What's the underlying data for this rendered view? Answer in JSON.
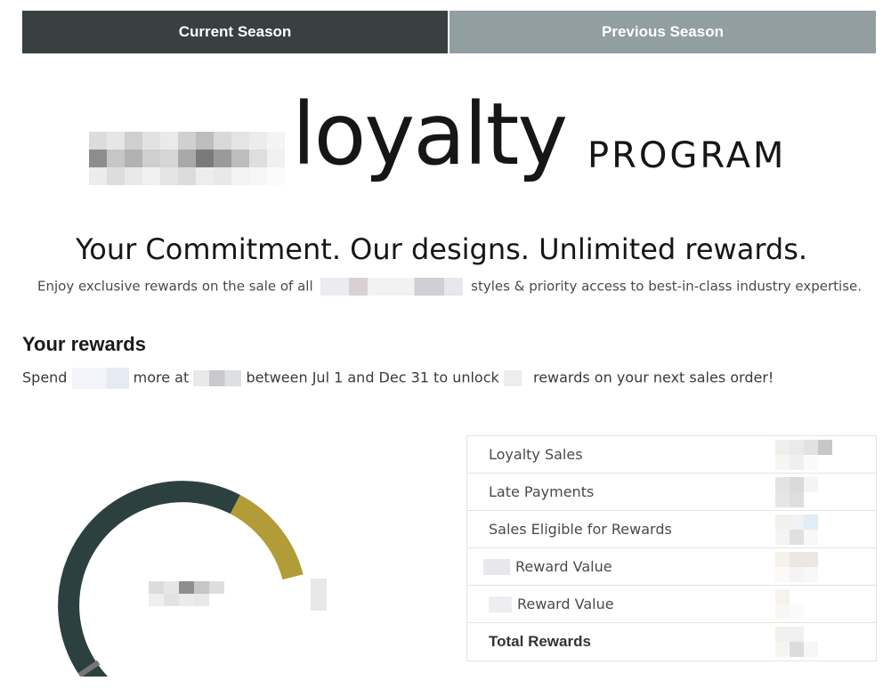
{
  "tabs": {
    "current": "Current Season",
    "previous": "Previous Season"
  },
  "logo": {
    "word": "loyalty",
    "suffix": "PROGRAM"
  },
  "hero": {
    "tagline": "Your Commitment. Our designs. Unlimited rewards.",
    "sub_before": "Enjoy exclusive rewards on the sale of all",
    "sub_after": "styles & priority access to best-in-class industry expertise."
  },
  "rewards": {
    "title": "Your rewards",
    "p1": "Spend",
    "p2": "more at",
    "p3": "between Jul 1 and Dec 31 to unlock",
    "p4": "rewards on your next sales order!"
  },
  "gauge": {
    "progress": 0.12,
    "colors": {
      "track": "#2c4040",
      "filled": "#b19c37",
      "needle": "#777777"
    }
  },
  "table": {
    "rows": [
      {
        "label": "Loyalty Sales"
      },
      {
        "label": "Late Payments"
      },
      {
        "label": "Sales Eligible for Rewards"
      },
      {
        "label": "Reward Value"
      },
      {
        "label": "Reward Value"
      },
      {
        "label": "Total Rewards"
      }
    ]
  },
  "colors": {
    "tab_active": "#384042",
    "tab_inactive": "#929fa0",
    "accent_gold": "#b19c37",
    "gauge_dark": "#2c4040"
  }
}
